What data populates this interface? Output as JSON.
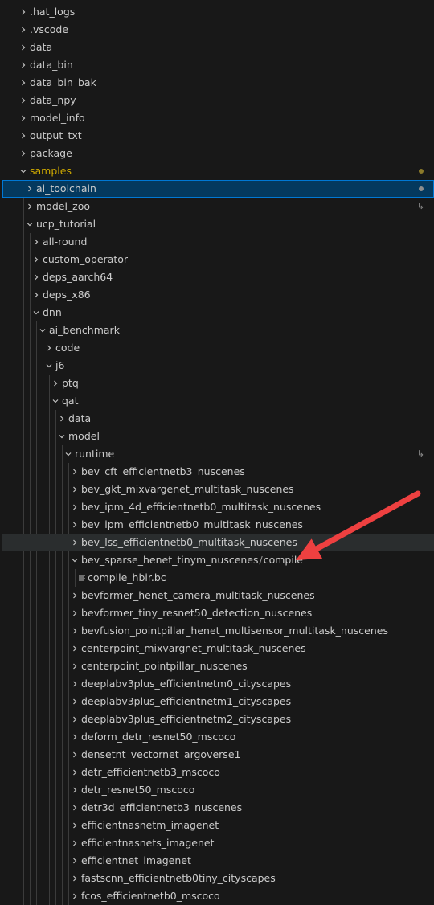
{
  "explorer": {
    "items": [
      {
        "label": ".hat_logs",
        "depth": 0,
        "kind": "folder",
        "expanded": false
      },
      {
        "label": ".vscode",
        "depth": 0,
        "kind": "folder",
        "expanded": false
      },
      {
        "label": "data",
        "depth": 0,
        "kind": "folder",
        "expanded": false
      },
      {
        "label": "data_bin",
        "depth": 0,
        "kind": "folder",
        "expanded": false
      },
      {
        "label": "data_bin_bak",
        "depth": 0,
        "kind": "folder",
        "expanded": false
      },
      {
        "label": "data_npy",
        "depth": 0,
        "kind": "folder",
        "expanded": false
      },
      {
        "label": "model_info",
        "depth": 0,
        "kind": "folder",
        "expanded": false
      },
      {
        "label": "output_txt",
        "depth": 0,
        "kind": "folder",
        "expanded": false
      },
      {
        "label": "package",
        "depth": 0,
        "kind": "folder",
        "expanded": false
      },
      {
        "label": "samples",
        "depth": 0,
        "kind": "folder",
        "expanded": true,
        "color": "#cca700",
        "badge": "modified-dot",
        "badge_color": "#8c7a2a"
      },
      {
        "label": "ai_toolchain",
        "depth": 1,
        "kind": "folder",
        "expanded": false,
        "state": "selected",
        "badge": "modified-dot",
        "badge_color": "#8e8e8e"
      },
      {
        "label": "model_zoo",
        "depth": 1,
        "kind": "folder",
        "expanded": false,
        "badge": "symlink",
        "badge_glyph": "↳"
      },
      {
        "label": "ucp_tutorial",
        "depth": 1,
        "kind": "folder",
        "expanded": true
      },
      {
        "label": "all-round",
        "depth": 2,
        "kind": "folder",
        "expanded": false
      },
      {
        "label": "custom_operator",
        "depth": 2,
        "kind": "folder",
        "expanded": false
      },
      {
        "label": "deps_aarch64",
        "depth": 2,
        "kind": "folder",
        "expanded": false
      },
      {
        "label": "deps_x86",
        "depth": 2,
        "kind": "folder",
        "expanded": false
      },
      {
        "label": "dnn",
        "depth": 2,
        "kind": "folder",
        "expanded": true
      },
      {
        "label": "ai_benchmark",
        "depth": 3,
        "kind": "folder",
        "expanded": true
      },
      {
        "label": "code",
        "depth": 4,
        "kind": "folder",
        "expanded": false
      },
      {
        "label": "j6",
        "depth": 4,
        "kind": "folder",
        "expanded": true
      },
      {
        "label": "ptq",
        "depth": 5,
        "kind": "folder",
        "expanded": false
      },
      {
        "label": "qat",
        "depth": 5,
        "kind": "folder",
        "expanded": true
      },
      {
        "label": "data",
        "depth": 6,
        "kind": "folder",
        "expanded": false
      },
      {
        "label": "model",
        "depth": 6,
        "kind": "folder",
        "expanded": true
      },
      {
        "label": "runtime",
        "depth": 7,
        "kind": "folder",
        "expanded": true,
        "badge": "symlink",
        "badge_glyph": "↳"
      },
      {
        "label": "bev_cft_efficientnetb3_nuscenes",
        "depth": 8,
        "kind": "folder",
        "expanded": false
      },
      {
        "label": "bev_gkt_mixvargenet_multitask_nuscenes",
        "depth": 8,
        "kind": "folder",
        "expanded": false
      },
      {
        "label": "bev_ipm_4d_efficientnetb0_multitask_nuscenes",
        "depth": 8,
        "kind": "folder",
        "expanded": false
      },
      {
        "label": "bev_ipm_efficientnetb0_multitask_nuscenes",
        "depth": 8,
        "kind": "folder",
        "expanded": false
      },
      {
        "label": "bev_lss_efficientnetb0_multitask_nuscenes",
        "depth": 8,
        "kind": "folder",
        "expanded": false,
        "state": "hovered"
      },
      {
        "label": "bev_sparse_henet_tinym_nuscenes",
        "suffix": "compile",
        "depth": 8,
        "kind": "folder",
        "expanded": true
      },
      {
        "label": "compile_hbir.bc",
        "depth": 9,
        "kind": "file"
      },
      {
        "label": "bevformer_henet_camera_multitask_nuscenes",
        "depth": 8,
        "kind": "folder",
        "expanded": false
      },
      {
        "label": "bevformer_tiny_resnet50_detection_nuscenes",
        "depth": 8,
        "kind": "folder",
        "expanded": false
      },
      {
        "label": "bevfusion_pointpillar_henet_multisensor_multitask_nuscenes",
        "depth": 8,
        "kind": "folder",
        "expanded": false
      },
      {
        "label": "centerpoint_mixvargnet_multitask_nuscenes",
        "depth": 8,
        "kind": "folder",
        "expanded": false
      },
      {
        "label": "centerpoint_pointpillar_nuscenes",
        "depth": 8,
        "kind": "folder",
        "expanded": false
      },
      {
        "label": "deeplabv3plus_efficientnetm0_cityscapes",
        "depth": 8,
        "kind": "folder",
        "expanded": false
      },
      {
        "label": "deeplabv3plus_efficientnetm1_cityscapes",
        "depth": 8,
        "kind": "folder",
        "expanded": false
      },
      {
        "label": "deeplabv3plus_efficientnetm2_cityscapes",
        "depth": 8,
        "kind": "folder",
        "expanded": false
      },
      {
        "label": "deform_detr_resnet50_mscoco",
        "depth": 8,
        "kind": "folder",
        "expanded": false
      },
      {
        "label": "densetnt_vectornet_argoverse1",
        "depth": 8,
        "kind": "folder",
        "expanded": false
      },
      {
        "label": "detr_efficientnetb3_mscoco",
        "depth": 8,
        "kind": "folder",
        "expanded": false
      },
      {
        "label": "detr_resnet50_mscoco",
        "depth": 8,
        "kind": "folder",
        "expanded": false
      },
      {
        "label": "detr3d_efficientnetb3_nuscenes",
        "depth": 8,
        "kind": "folder",
        "expanded": false
      },
      {
        "label": "efficientnasnetm_imagenet",
        "depth": 8,
        "kind": "folder",
        "expanded": false
      },
      {
        "label": "efficientnasnets_imagenet",
        "depth": 8,
        "kind": "folder",
        "expanded": false
      },
      {
        "label": "efficientnet_imagenet",
        "depth": 8,
        "kind": "folder",
        "expanded": false
      },
      {
        "label": "fastscnn_efficientnetb0tiny_cityscapes",
        "depth": 8,
        "kind": "folder",
        "expanded": false
      },
      {
        "label": "fcos_efficientnetb0_mscoco",
        "depth": 8,
        "kind": "folder",
        "expanded": false
      }
    ]
  },
  "annotation": {
    "kind": "red-arrow",
    "color": "#ee4040",
    "points_to": "bev_sparse_henet_tinym_nuscenes"
  },
  "colors": {
    "background": "#181818",
    "text": "#cccccc",
    "selected_background": "#04395e",
    "selected_border": "#0078d4",
    "hover_background": "#2a2d2e",
    "modified_folder_text": "#cca700",
    "indent_guide": "#3b3b3b"
  }
}
